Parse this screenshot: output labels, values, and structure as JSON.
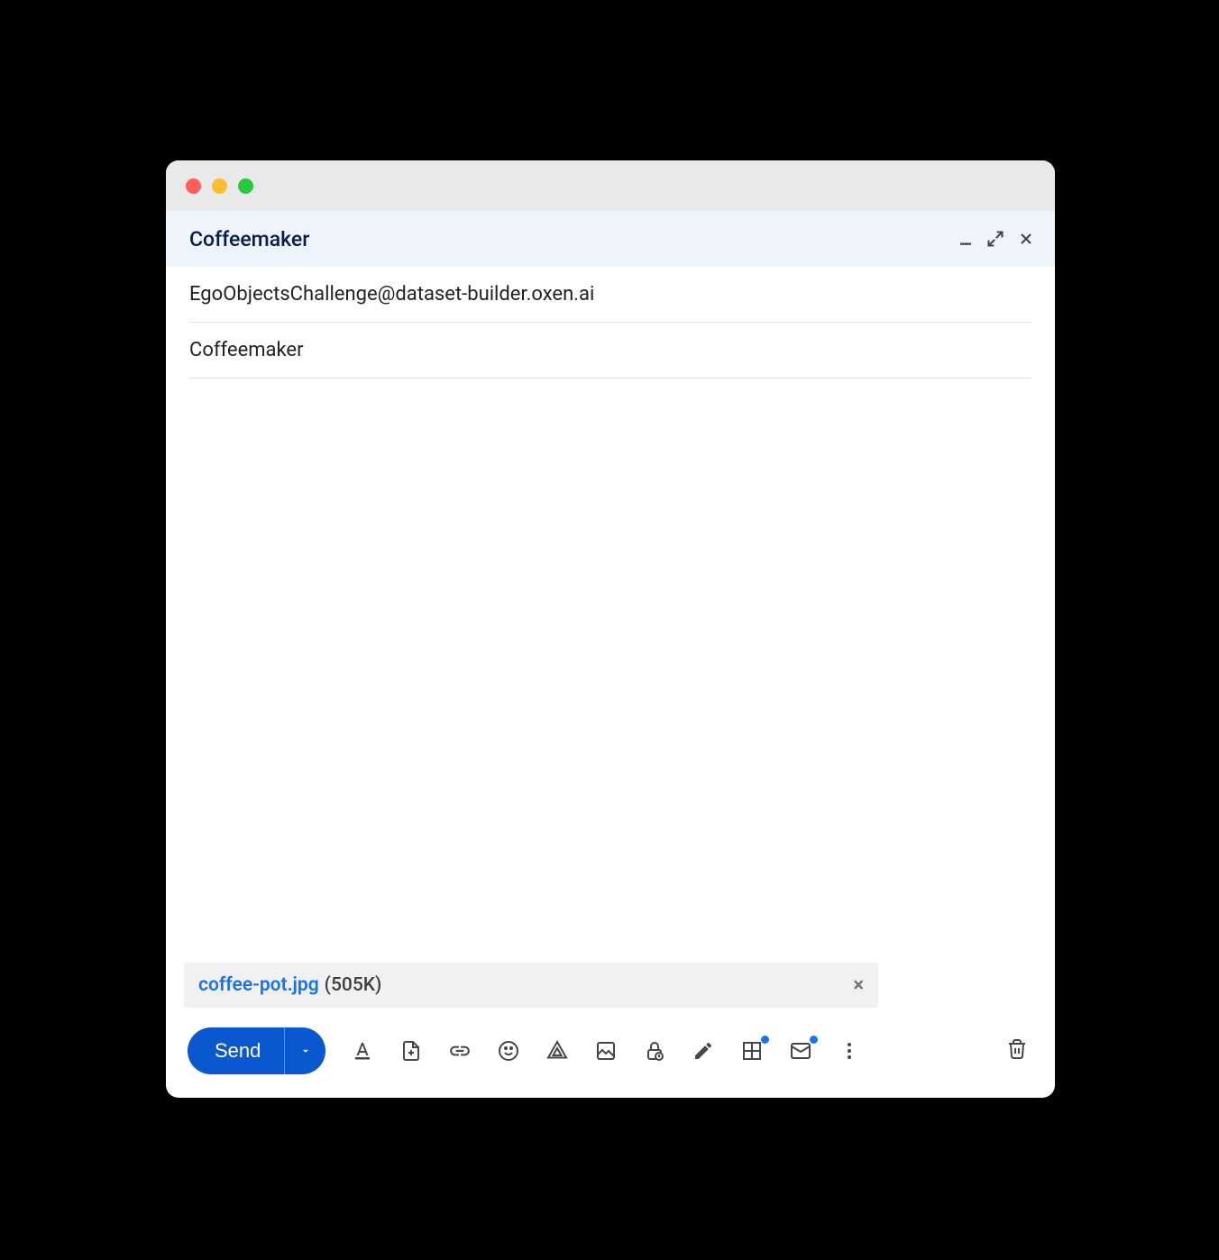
{
  "compose": {
    "title": "Coffeemaker",
    "to": "EgoObjectsChallenge@dataset-builder.oxen.ai",
    "subject": "Coffeemaker",
    "body": ""
  },
  "attachment": {
    "name": "coffee-pot.jpg",
    "size": "(505K)"
  },
  "toolbar": {
    "send_label": "Send"
  }
}
